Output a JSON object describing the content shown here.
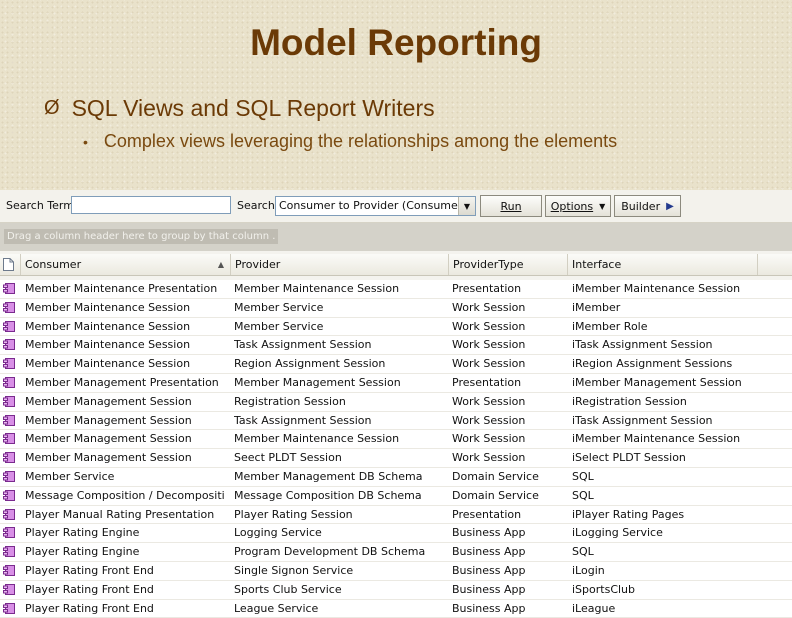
{
  "slide": {
    "title": "Model Reporting",
    "bullet1_marker": "Ø",
    "bullet1": "SQL Views and SQL Report Writers",
    "bullet2_marker": "•",
    "bullet2": "Complex views leveraging the relationships among the elements"
  },
  "toolbar": {
    "search_term_label": "Search Term:",
    "search_term_value": "",
    "search_label": "Search:",
    "search_select_value": "Consumer to Provider (Consumer)",
    "run_label": "Run",
    "options_label": "Options",
    "builder_label": "Builder"
  },
  "group_hint": "Drag a column header here to group by that column .",
  "columns": [
    "Consumer",
    "Provider",
    "ProviderType",
    "Interface"
  ],
  "rows": [
    {
      "consumer": "Member Maintenance Presentation",
      "provider": "Member Maintenance Session",
      "type": "Presentation",
      "interface": "iMember Maintenance Session"
    },
    {
      "consumer": "Member Maintenance Session",
      "provider": "Member Service",
      "type": "Work Session",
      "interface": "iMember"
    },
    {
      "consumer": "Member Maintenance Session",
      "provider": "Member Service",
      "type": "Work Session",
      "interface": "iMember Role"
    },
    {
      "consumer": "Member Maintenance Session",
      "provider": "Task Assignment Session",
      "type": "Work Session",
      "interface": "iTask Assignment Session"
    },
    {
      "consumer": "Member Maintenance Session",
      "provider": "Region Assignment Session",
      "type": "Work Session",
      "interface": "iRegion Assignment Sessions"
    },
    {
      "consumer": "Member Management Presentation",
      "provider": "Member Management Session",
      "type": "Presentation",
      "interface": "iMember Management Session"
    },
    {
      "consumer": "Member Management Session",
      "provider": "Registration Session",
      "type": "Work Session",
      "interface": "iRegistration Session"
    },
    {
      "consumer": "Member Management Session",
      "provider": "Task Assignment Session",
      "type": "Work Session",
      "interface": "iTask Assignment Session"
    },
    {
      "consumer": "Member Management Session",
      "provider": "Member Maintenance Session",
      "type": "Work Session",
      "interface": "iMember Maintenance Session"
    },
    {
      "consumer": "Member Management Session",
      "provider": "Seect PLDT Session",
      "type": "Work Session",
      "interface": "iSelect PLDT Session"
    },
    {
      "consumer": "Member Service",
      "provider": "Member Management DB Schema",
      "type": "Domain Service",
      "interface": "SQL"
    },
    {
      "consumer": "Message Composition / Decomposition S...",
      "provider": "Message Composition DB Schema",
      "type": "Domain Service",
      "interface": "SQL"
    },
    {
      "consumer": "Player Manual Rating Presentation",
      "provider": "Player Rating Session",
      "type": "Presentation",
      "interface": "iPlayer Rating Pages"
    },
    {
      "consumer": "Player Rating Engine",
      "provider": "Logging Service",
      "type": "Business App",
      "interface": "iLogging Service"
    },
    {
      "consumer": "Player Rating Engine",
      "provider": "Program Development DB Schema",
      "type": "Business App",
      "interface": "SQL"
    },
    {
      "consumer": "Player Rating Front End",
      "provider": "Single Signon Service",
      "type": "Business App",
      "interface": "iLogin"
    },
    {
      "consumer": "Player Rating Front End",
      "provider": "Sports Club Service",
      "type": "Business App",
      "interface": "iSportsClub"
    },
    {
      "consumer": "Player Rating Front End",
      "provider": "League Service",
      "type": "Business App",
      "interface": "iLeague"
    }
  ],
  "colors": {
    "title": "#6b3a06",
    "icon": "#b04fc7"
  }
}
